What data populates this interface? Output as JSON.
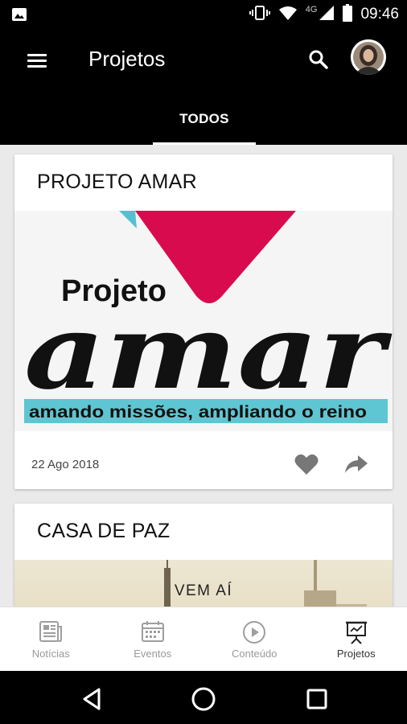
{
  "status_bar": {
    "time": "09:46",
    "network": "4G",
    "icons": [
      "image-icon",
      "vibrate-icon",
      "wifi-icon",
      "cell-signal-icon",
      "battery-icon"
    ]
  },
  "app_bar": {
    "title": "Projetos",
    "tabs": [
      {
        "label": "TODOS",
        "active": true
      }
    ],
    "icons": [
      "menu-icon",
      "search-icon",
      "avatar"
    ]
  },
  "cards": [
    {
      "title": "PROJETO AMAR",
      "image": {
        "word_small": "Projeto",
        "word_big": "amar",
        "tagline": "amando missões, ampliando o reino"
      },
      "date": "22 Ago 2018",
      "actions": [
        "heart-icon",
        "share-icon"
      ]
    },
    {
      "title": "CASA DE PAZ",
      "image": {
        "text": "VEM AÍ"
      }
    }
  ],
  "bottom_nav": {
    "items": [
      {
        "label": "Notícias",
        "icon": "newspaper-icon",
        "active": false
      },
      {
        "label": "Eventos",
        "icon": "calendar-icon",
        "active": false
      },
      {
        "label": "Conteúdo",
        "icon": "play-circle-icon",
        "active": false
      },
      {
        "label": "Projetos",
        "icon": "presentation-icon",
        "active": true
      }
    ]
  },
  "colors": {
    "app_bar": "#000000",
    "heart_shape": "#d90b4f",
    "heart_accent": "#54c0d0",
    "tagline_band": "#5ec6d2",
    "inactive_icon": "#9e9e9e",
    "active_icon": "#222222"
  }
}
